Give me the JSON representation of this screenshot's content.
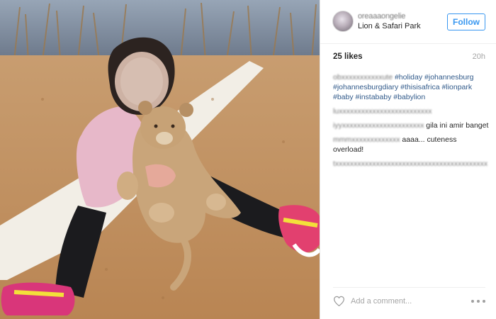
{
  "post": {
    "username": "oreaaaongelie",
    "location": "Lion & Safari Park",
    "follow_label": "Follow",
    "likes": "25 likes",
    "time": "20h",
    "caption": {
      "author_blur": "ob",
      "author_blur_2": "ute",
      "tags": [
        "#holiday",
        "#johannesburg",
        "#johannesburgdiary",
        "#thisisafrica",
        "#lionpark",
        "#baby",
        "#instababy",
        "#babylion"
      ]
    },
    "comments": [
      {
        "prefix_blur": "lu",
        "text": ""
      },
      {
        "prefix_blur": "iyy",
        "text": "gila ini amir banget"
      },
      {
        "prefix_blur": "mmm",
        "text": "aaaa... cuteness overload!"
      },
      {
        "prefix_blur": "t",
        "text": ""
      }
    ],
    "add_comment_placeholder": "Add a comment..."
  },
  "icons": {
    "like": "heart-icon",
    "options": "more-options-icon"
  },
  "colors": {
    "accent": "#3897f0",
    "hashtag": "#315a8a",
    "text": "#262626",
    "muted": "#a5a5a5"
  }
}
